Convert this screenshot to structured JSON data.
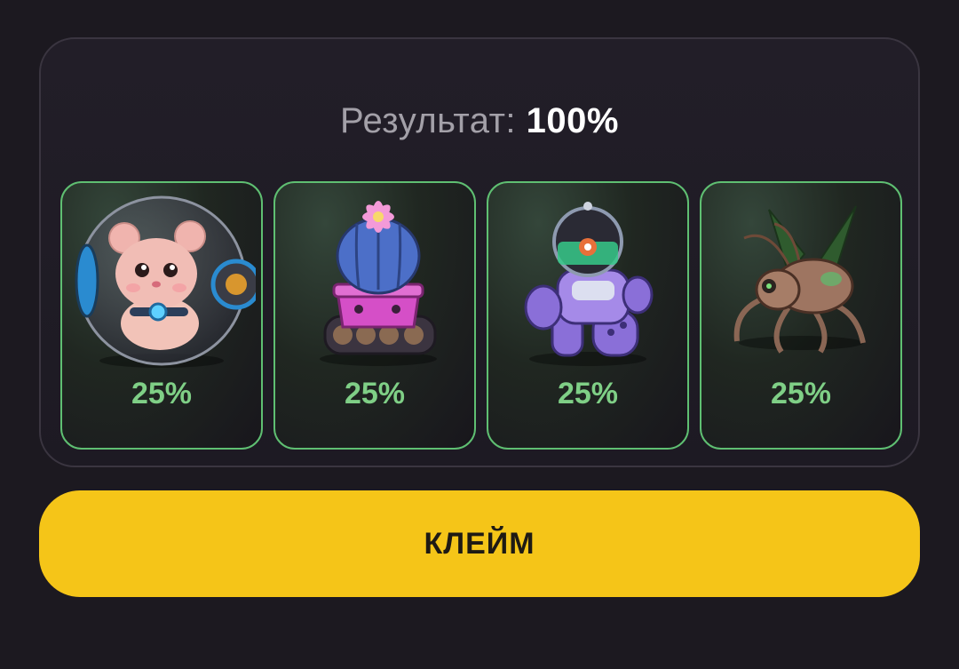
{
  "result": {
    "label": "Результат:",
    "value": "100%"
  },
  "cards": [
    {
      "character": "hamster-in-ball",
      "percent": "25%"
    },
    {
      "character": "cactus-tank",
      "percent": "25%"
    },
    {
      "character": "fishbowl-robot",
      "percent": "25%"
    },
    {
      "character": "mech-insect",
      "percent": "25%"
    }
  ],
  "claim_button": {
    "label": "КЛЕЙМ"
  },
  "colors": {
    "background": "#1c1920",
    "card_border": "#5fbf72",
    "percent_text": "#7fcf86",
    "button": "#f5c518"
  }
}
